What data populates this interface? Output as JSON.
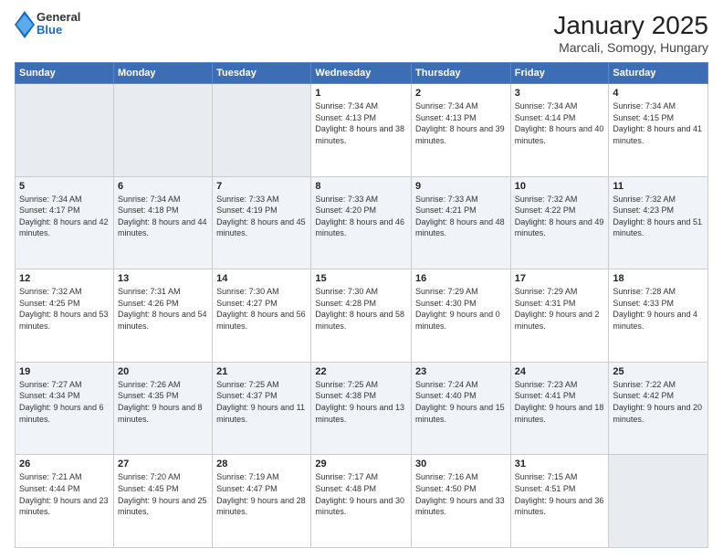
{
  "logo": {
    "general": "General",
    "blue": "Blue"
  },
  "title": "January 2025",
  "subtitle": "Marcali, Somogy, Hungary",
  "weekdays": [
    "Sunday",
    "Monday",
    "Tuesday",
    "Wednesday",
    "Thursday",
    "Friday",
    "Saturday"
  ],
  "weeks": [
    [
      {
        "day": "",
        "info": ""
      },
      {
        "day": "",
        "info": ""
      },
      {
        "day": "",
        "info": ""
      },
      {
        "day": "1",
        "info": "Sunrise: 7:34 AM\nSunset: 4:13 PM\nDaylight: 8 hours and 38 minutes."
      },
      {
        "day": "2",
        "info": "Sunrise: 7:34 AM\nSunset: 4:13 PM\nDaylight: 8 hours and 39 minutes."
      },
      {
        "day": "3",
        "info": "Sunrise: 7:34 AM\nSunset: 4:14 PM\nDaylight: 8 hours and 40 minutes."
      },
      {
        "day": "4",
        "info": "Sunrise: 7:34 AM\nSunset: 4:15 PM\nDaylight: 8 hours and 41 minutes."
      }
    ],
    [
      {
        "day": "5",
        "info": "Sunrise: 7:34 AM\nSunset: 4:17 PM\nDaylight: 8 hours and 42 minutes."
      },
      {
        "day": "6",
        "info": "Sunrise: 7:34 AM\nSunset: 4:18 PM\nDaylight: 8 hours and 44 minutes."
      },
      {
        "day": "7",
        "info": "Sunrise: 7:33 AM\nSunset: 4:19 PM\nDaylight: 8 hours and 45 minutes."
      },
      {
        "day": "8",
        "info": "Sunrise: 7:33 AM\nSunset: 4:20 PM\nDaylight: 8 hours and 46 minutes."
      },
      {
        "day": "9",
        "info": "Sunrise: 7:33 AM\nSunset: 4:21 PM\nDaylight: 8 hours and 48 minutes."
      },
      {
        "day": "10",
        "info": "Sunrise: 7:32 AM\nSunset: 4:22 PM\nDaylight: 8 hours and 49 minutes."
      },
      {
        "day": "11",
        "info": "Sunrise: 7:32 AM\nSunset: 4:23 PM\nDaylight: 8 hours and 51 minutes."
      }
    ],
    [
      {
        "day": "12",
        "info": "Sunrise: 7:32 AM\nSunset: 4:25 PM\nDaylight: 8 hours and 53 minutes."
      },
      {
        "day": "13",
        "info": "Sunrise: 7:31 AM\nSunset: 4:26 PM\nDaylight: 8 hours and 54 minutes."
      },
      {
        "day": "14",
        "info": "Sunrise: 7:30 AM\nSunset: 4:27 PM\nDaylight: 8 hours and 56 minutes."
      },
      {
        "day": "15",
        "info": "Sunrise: 7:30 AM\nSunset: 4:28 PM\nDaylight: 8 hours and 58 minutes."
      },
      {
        "day": "16",
        "info": "Sunrise: 7:29 AM\nSunset: 4:30 PM\nDaylight: 9 hours and 0 minutes."
      },
      {
        "day": "17",
        "info": "Sunrise: 7:29 AM\nSunset: 4:31 PM\nDaylight: 9 hours and 2 minutes."
      },
      {
        "day": "18",
        "info": "Sunrise: 7:28 AM\nSunset: 4:33 PM\nDaylight: 9 hours and 4 minutes."
      }
    ],
    [
      {
        "day": "19",
        "info": "Sunrise: 7:27 AM\nSunset: 4:34 PM\nDaylight: 9 hours and 6 minutes."
      },
      {
        "day": "20",
        "info": "Sunrise: 7:26 AM\nSunset: 4:35 PM\nDaylight: 9 hours and 8 minutes."
      },
      {
        "day": "21",
        "info": "Sunrise: 7:25 AM\nSunset: 4:37 PM\nDaylight: 9 hours and 11 minutes."
      },
      {
        "day": "22",
        "info": "Sunrise: 7:25 AM\nSunset: 4:38 PM\nDaylight: 9 hours and 13 minutes."
      },
      {
        "day": "23",
        "info": "Sunrise: 7:24 AM\nSunset: 4:40 PM\nDaylight: 9 hours and 15 minutes."
      },
      {
        "day": "24",
        "info": "Sunrise: 7:23 AM\nSunset: 4:41 PM\nDaylight: 9 hours and 18 minutes."
      },
      {
        "day": "25",
        "info": "Sunrise: 7:22 AM\nSunset: 4:42 PM\nDaylight: 9 hours and 20 minutes."
      }
    ],
    [
      {
        "day": "26",
        "info": "Sunrise: 7:21 AM\nSunset: 4:44 PM\nDaylight: 9 hours and 23 minutes."
      },
      {
        "day": "27",
        "info": "Sunrise: 7:20 AM\nSunset: 4:45 PM\nDaylight: 9 hours and 25 minutes."
      },
      {
        "day": "28",
        "info": "Sunrise: 7:19 AM\nSunset: 4:47 PM\nDaylight: 9 hours and 28 minutes."
      },
      {
        "day": "29",
        "info": "Sunrise: 7:17 AM\nSunset: 4:48 PM\nDaylight: 9 hours and 30 minutes."
      },
      {
        "day": "30",
        "info": "Sunrise: 7:16 AM\nSunset: 4:50 PM\nDaylight: 9 hours and 33 minutes."
      },
      {
        "day": "31",
        "info": "Sunrise: 7:15 AM\nSunset: 4:51 PM\nDaylight: 9 hours and 36 minutes."
      },
      {
        "day": "",
        "info": ""
      }
    ]
  ]
}
